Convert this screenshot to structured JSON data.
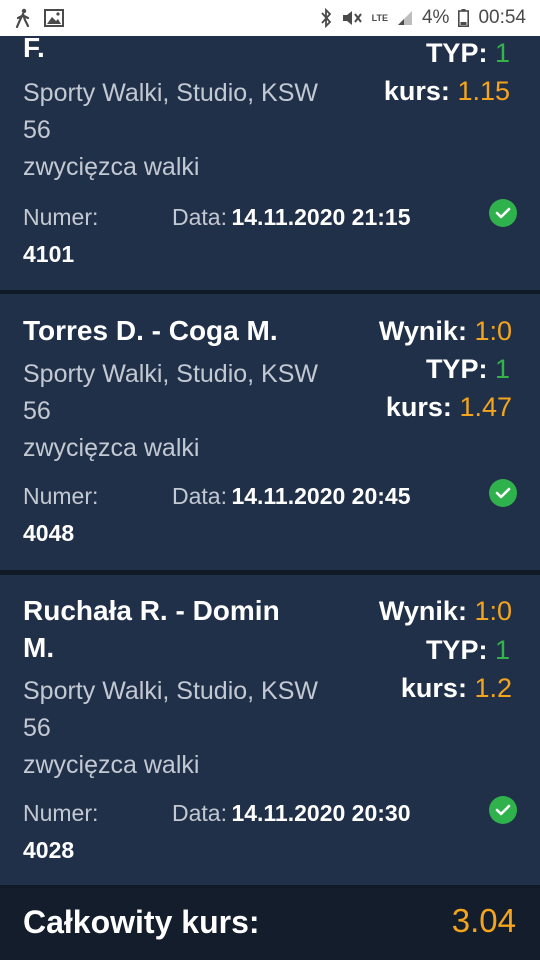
{
  "status_bar": {
    "battery": "4%",
    "time": "00:54",
    "network": "LTE",
    "icons": [
      "walk-icon",
      "image-icon",
      "bluetooth-icon",
      "mute-icon",
      "signal-icon",
      "battery-icon"
    ]
  },
  "labels": {
    "numer": "Numer:",
    "data": "Data:",
    "wynik": "Wynik:",
    "typ": "TYP:",
    "kurs": "kurs:"
  },
  "bets": [
    {
      "teams_tail": "F.",
      "league_line1": "Sporty Walki, Studio, KSW",
      "league_line2": "56",
      "market": "zwycięzca walki",
      "typ": "1",
      "kurs": "1.15",
      "numer": "4101",
      "data": "14.11.2020 21:15",
      "status": "won"
    },
    {
      "teams": "Torres D. - Coga M.",
      "league_line1": "Sporty Walki, Studio, KSW",
      "league_line2": "56",
      "market": "zwycięzca walki",
      "wynik": "1:0",
      "typ": "1",
      "kurs": "1.47",
      "numer": "4048",
      "data": "14.11.2020 20:45",
      "status": "won"
    },
    {
      "teams_line1": "Ruchała R. - Domin",
      "teams_line2": "M.",
      "league_line1": "Sporty Walki, Studio, KSW",
      "league_line2": "56",
      "market": "zwycięzca walki",
      "wynik": "1:0",
      "typ": "1",
      "kurs": "1.2",
      "numer": "4028",
      "data": "14.11.2020 20:30",
      "status": "won"
    }
  ],
  "footer": {
    "label": "Całkowity kurs:",
    "value": "3.04"
  },
  "colors": {
    "card_bg": "#213049",
    "page_bg": "#101a27",
    "typ_green": "#35b34a",
    "kurs_orange": "#f4a51c",
    "check_green": "#2fb14b"
  }
}
